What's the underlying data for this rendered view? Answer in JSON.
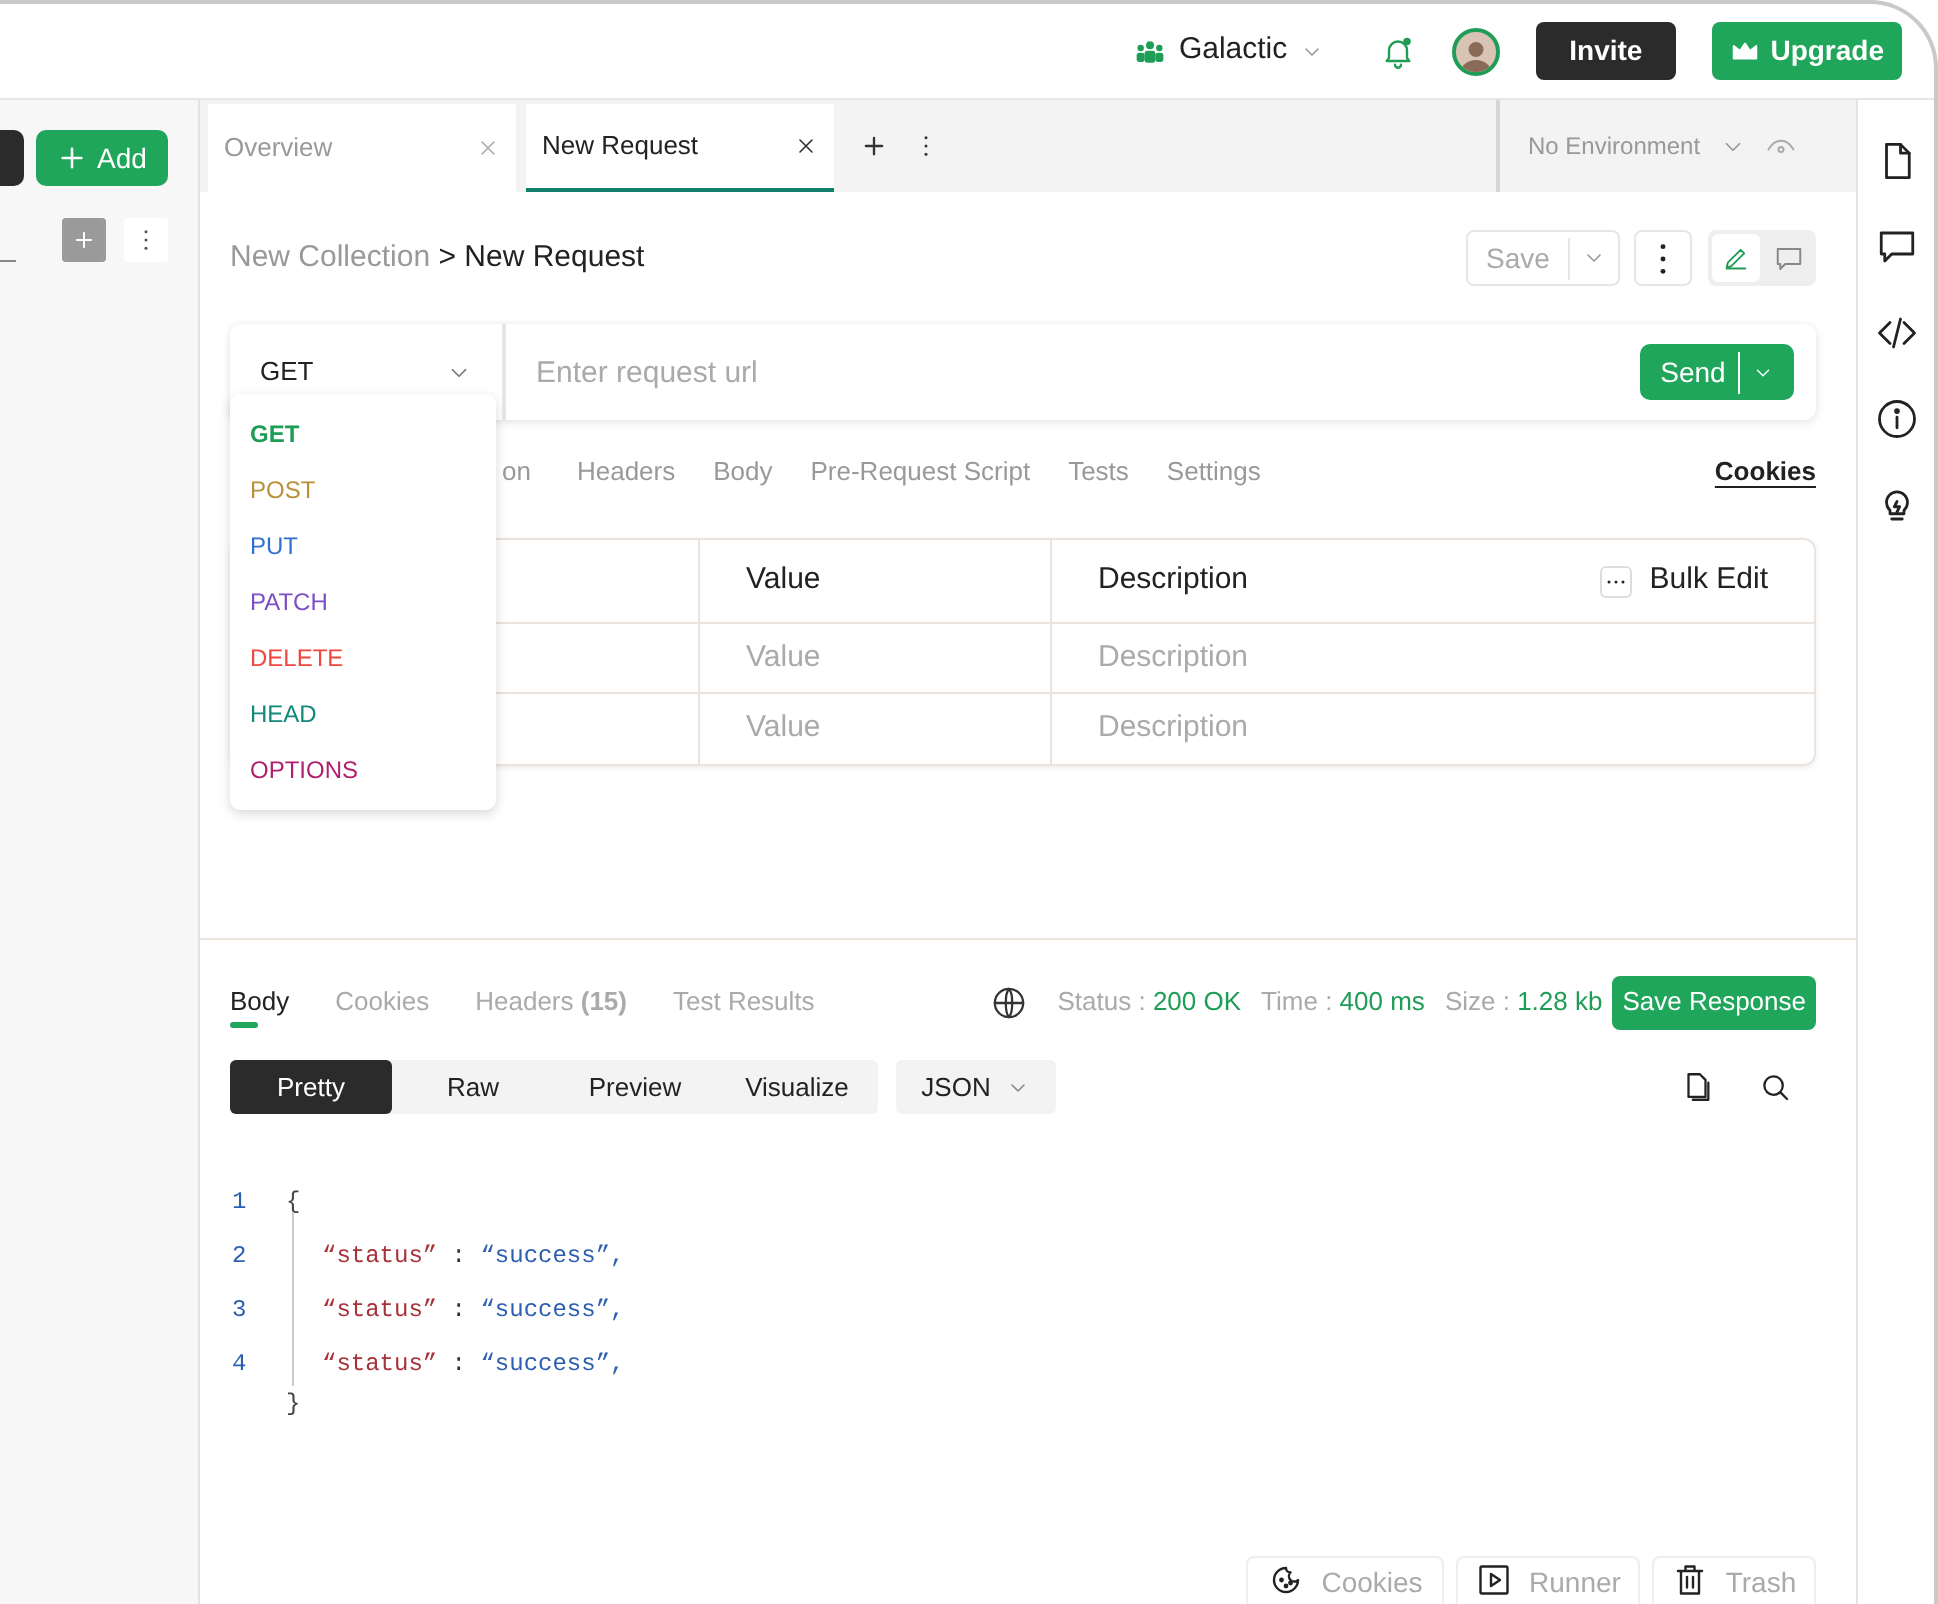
{
  "header": {
    "workspace": "Galactic",
    "invite": "Invite",
    "upgrade": "Upgrade"
  },
  "sidebar": {
    "add_button": "Add"
  },
  "tabs": [
    {
      "label": "Overview",
      "selected": false
    },
    {
      "label": "New Request",
      "selected": true
    }
  ],
  "environment": {
    "value": "No Environment"
  },
  "breadcrumb": {
    "parent": "New Collection",
    "separator": ">",
    "current": "New Request"
  },
  "save_button": "Save",
  "request": {
    "method": "GET",
    "placeholder": "Enter request url",
    "send": "Send"
  },
  "method_options": [
    {
      "label": "GET",
      "color": "#1f9d57"
    },
    {
      "label": "POST",
      "color": "#b8913a"
    },
    {
      "label": "PUT",
      "color": "#2f6fd0"
    },
    {
      "label": "PATCH",
      "color": "#7d4ec4"
    },
    {
      "label": "DELETE",
      "color": "#f0483e"
    },
    {
      "label": "HEAD",
      "color": "#12897a"
    },
    {
      "label": "OPTIONS",
      "color": "#b0206e"
    }
  ],
  "request_tabs": [
    "on",
    "Headers",
    "Body",
    "Pre-Request Script",
    "Tests",
    "Settings"
  ],
  "cookies_link": "Cookies",
  "params_table": {
    "columns": [
      "Value",
      "Description"
    ],
    "bulk_edit": "Bulk Edit",
    "rows": [
      {
        "value": "Value",
        "description": "Description"
      },
      {
        "value": "Value",
        "description": "Description"
      }
    ]
  },
  "response_tabs": [
    {
      "label": "Body",
      "selected": true
    },
    {
      "label": "Cookies",
      "selected": false
    },
    {
      "label": "Headers **(15)**",
      "selected": false
    },
    {
      "label": "Test Results",
      "selected": false
    }
  ],
  "response_meta": [
    {
      "label": "Status :",
      "value": "200 OK"
    },
    {
      "label": "Time :",
      "value": "400 ms"
    },
    {
      "label": "Size :",
      "value": "1.28 kb"
    }
  ],
  "save_response": "Save Response",
  "view_modes": [
    {
      "label": "Pretty",
      "selected": true
    },
    {
      "label": "Raw",
      "selected": false
    },
    {
      "label": "Preview",
      "selected": false
    },
    {
      "label": "Visualize",
      "selected": false
    }
  ],
  "format": "JSON",
  "code": {
    "open": "{",
    "close": "}",
    "open_number": "1",
    "lines": [
      {
        "number": "2",
        "key": "“status”",
        "sep": ":",
        "value": "“success”,"
      },
      {
        "number": "3",
        "key": "“status”",
        "sep": ":",
        "value": "“success”,"
      },
      {
        "number": "4",
        "key": "“status”",
        "sep": ":",
        "value": "“success”,"
      }
    ]
  },
  "footer_buttons": [
    {
      "kind": "cookie",
      "label": "Cookies"
    },
    {
      "kind": "runner",
      "label": "Runner"
    },
    {
      "kind": "trash",
      "label": "Trash"
    }
  ]
}
